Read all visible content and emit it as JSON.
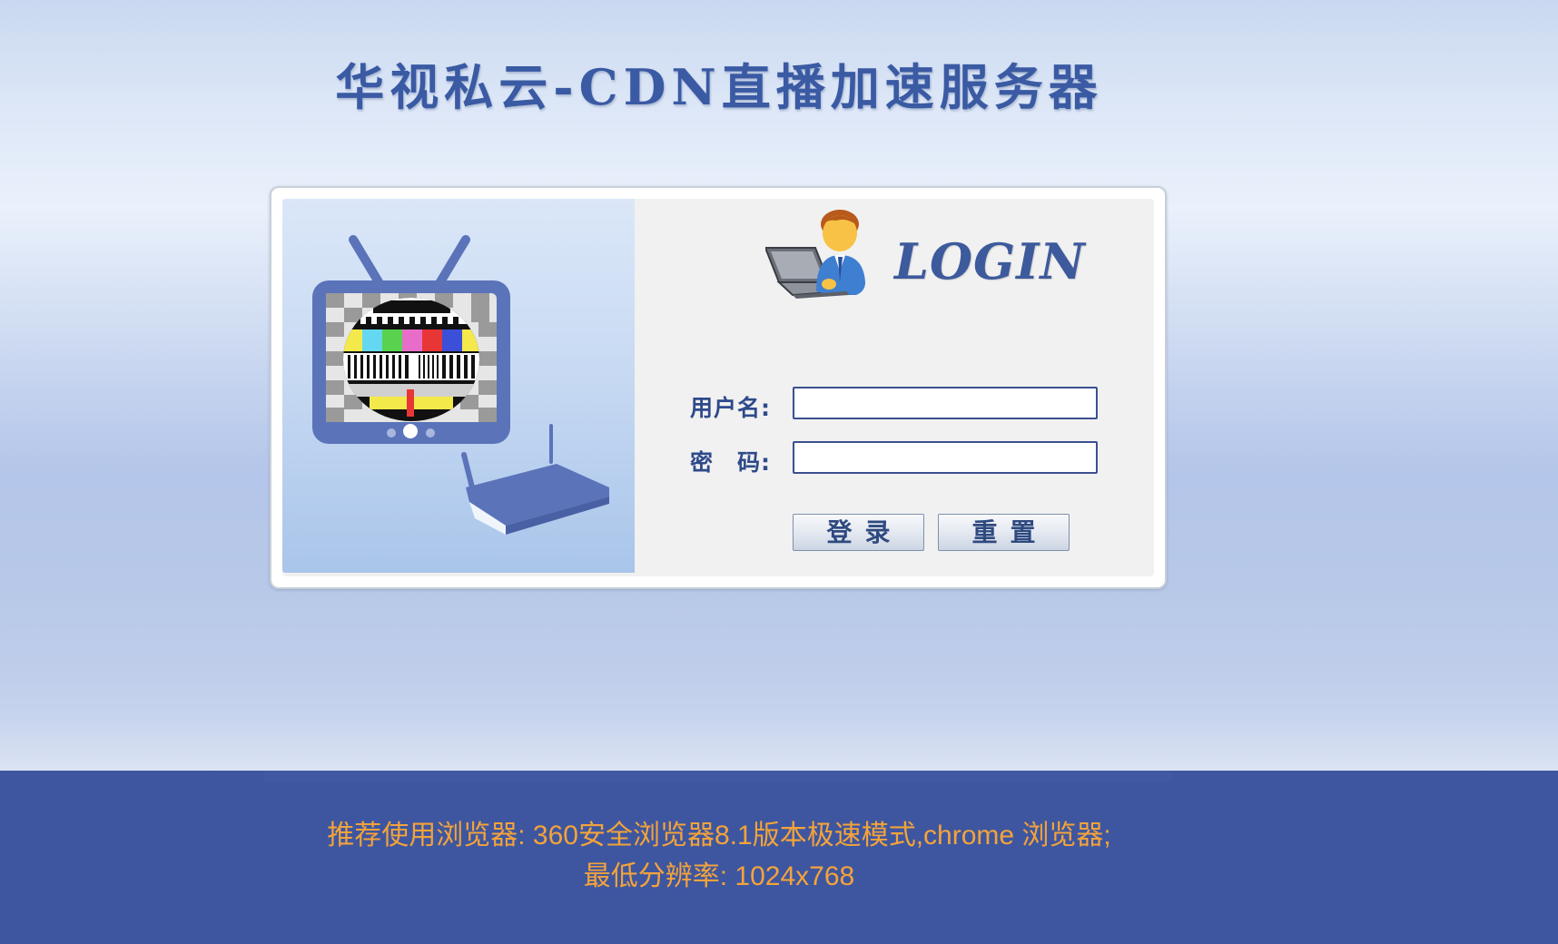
{
  "page": {
    "title": "华视私云-CDN直播加速服务器"
  },
  "login": {
    "logo_text": "LOGIN",
    "username_label": "用户名:",
    "password_label": "密　码:",
    "username_value": "",
    "password_value": "",
    "login_button": "登录",
    "reset_button": "重置"
  },
  "footer": {
    "browser_note": "推荐使用浏览器: 360安全浏览器8.1版本极速模式,chrome 浏览器;",
    "resolution_note": "最低分辨率: 1024x768"
  },
  "colors": {
    "title": "#3a5aa3",
    "label": "#2e4a8a",
    "footer_bg": "#3e56a0",
    "footer_text": "#f3a33a",
    "tv_frame": "#5b73b9"
  },
  "icons": {
    "tv": "tv-icon",
    "router": "router-icon",
    "user_laptop": "user-laptop-icon"
  }
}
